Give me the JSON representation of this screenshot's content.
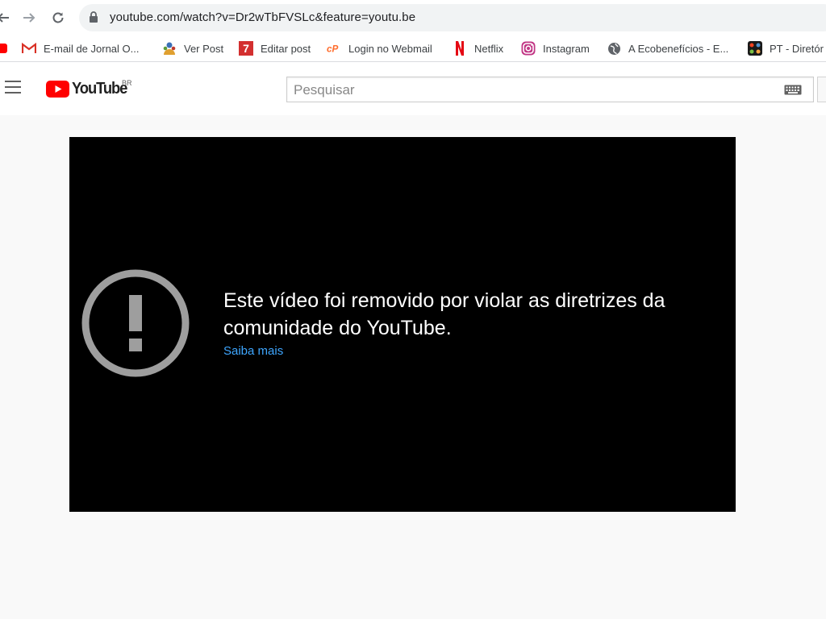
{
  "browser": {
    "url": "youtube.com/watch?v=Dr2wTbFVSLc&feature=youtu.be",
    "bookmarks": [
      {
        "label": "E-mail de Jornal O...",
        "icon": "gmail-icon"
      },
      {
        "label": "Ver Post",
        "icon": "user-group-icon"
      },
      {
        "label": "Editar post",
        "icon": "seven-icon"
      },
      {
        "label": "Login no Webmail",
        "icon": "cpanel-icon"
      },
      {
        "label": "Netflix",
        "icon": "netflix-icon"
      },
      {
        "label": "Instagram",
        "icon": "instagram-icon"
      },
      {
        "label": "A Ecobenefícios - E...",
        "icon": "globe-icon"
      },
      {
        "label": "PT - Diretór",
        "icon": "joomla-icon"
      }
    ]
  },
  "youtube": {
    "logo_text": "YouTube",
    "region": "BR",
    "search_placeholder": "Pesquisar"
  },
  "player": {
    "error_message": "Este vídeo foi removido por violar as diretrizes da comunidade do YouTube.",
    "learn_more": "Saiba mais"
  },
  "colors": {
    "youtube_red": "#ff0000",
    "link_blue": "#3ea6ff",
    "player_bg": "#000000",
    "page_bg": "#f9f9f9"
  }
}
